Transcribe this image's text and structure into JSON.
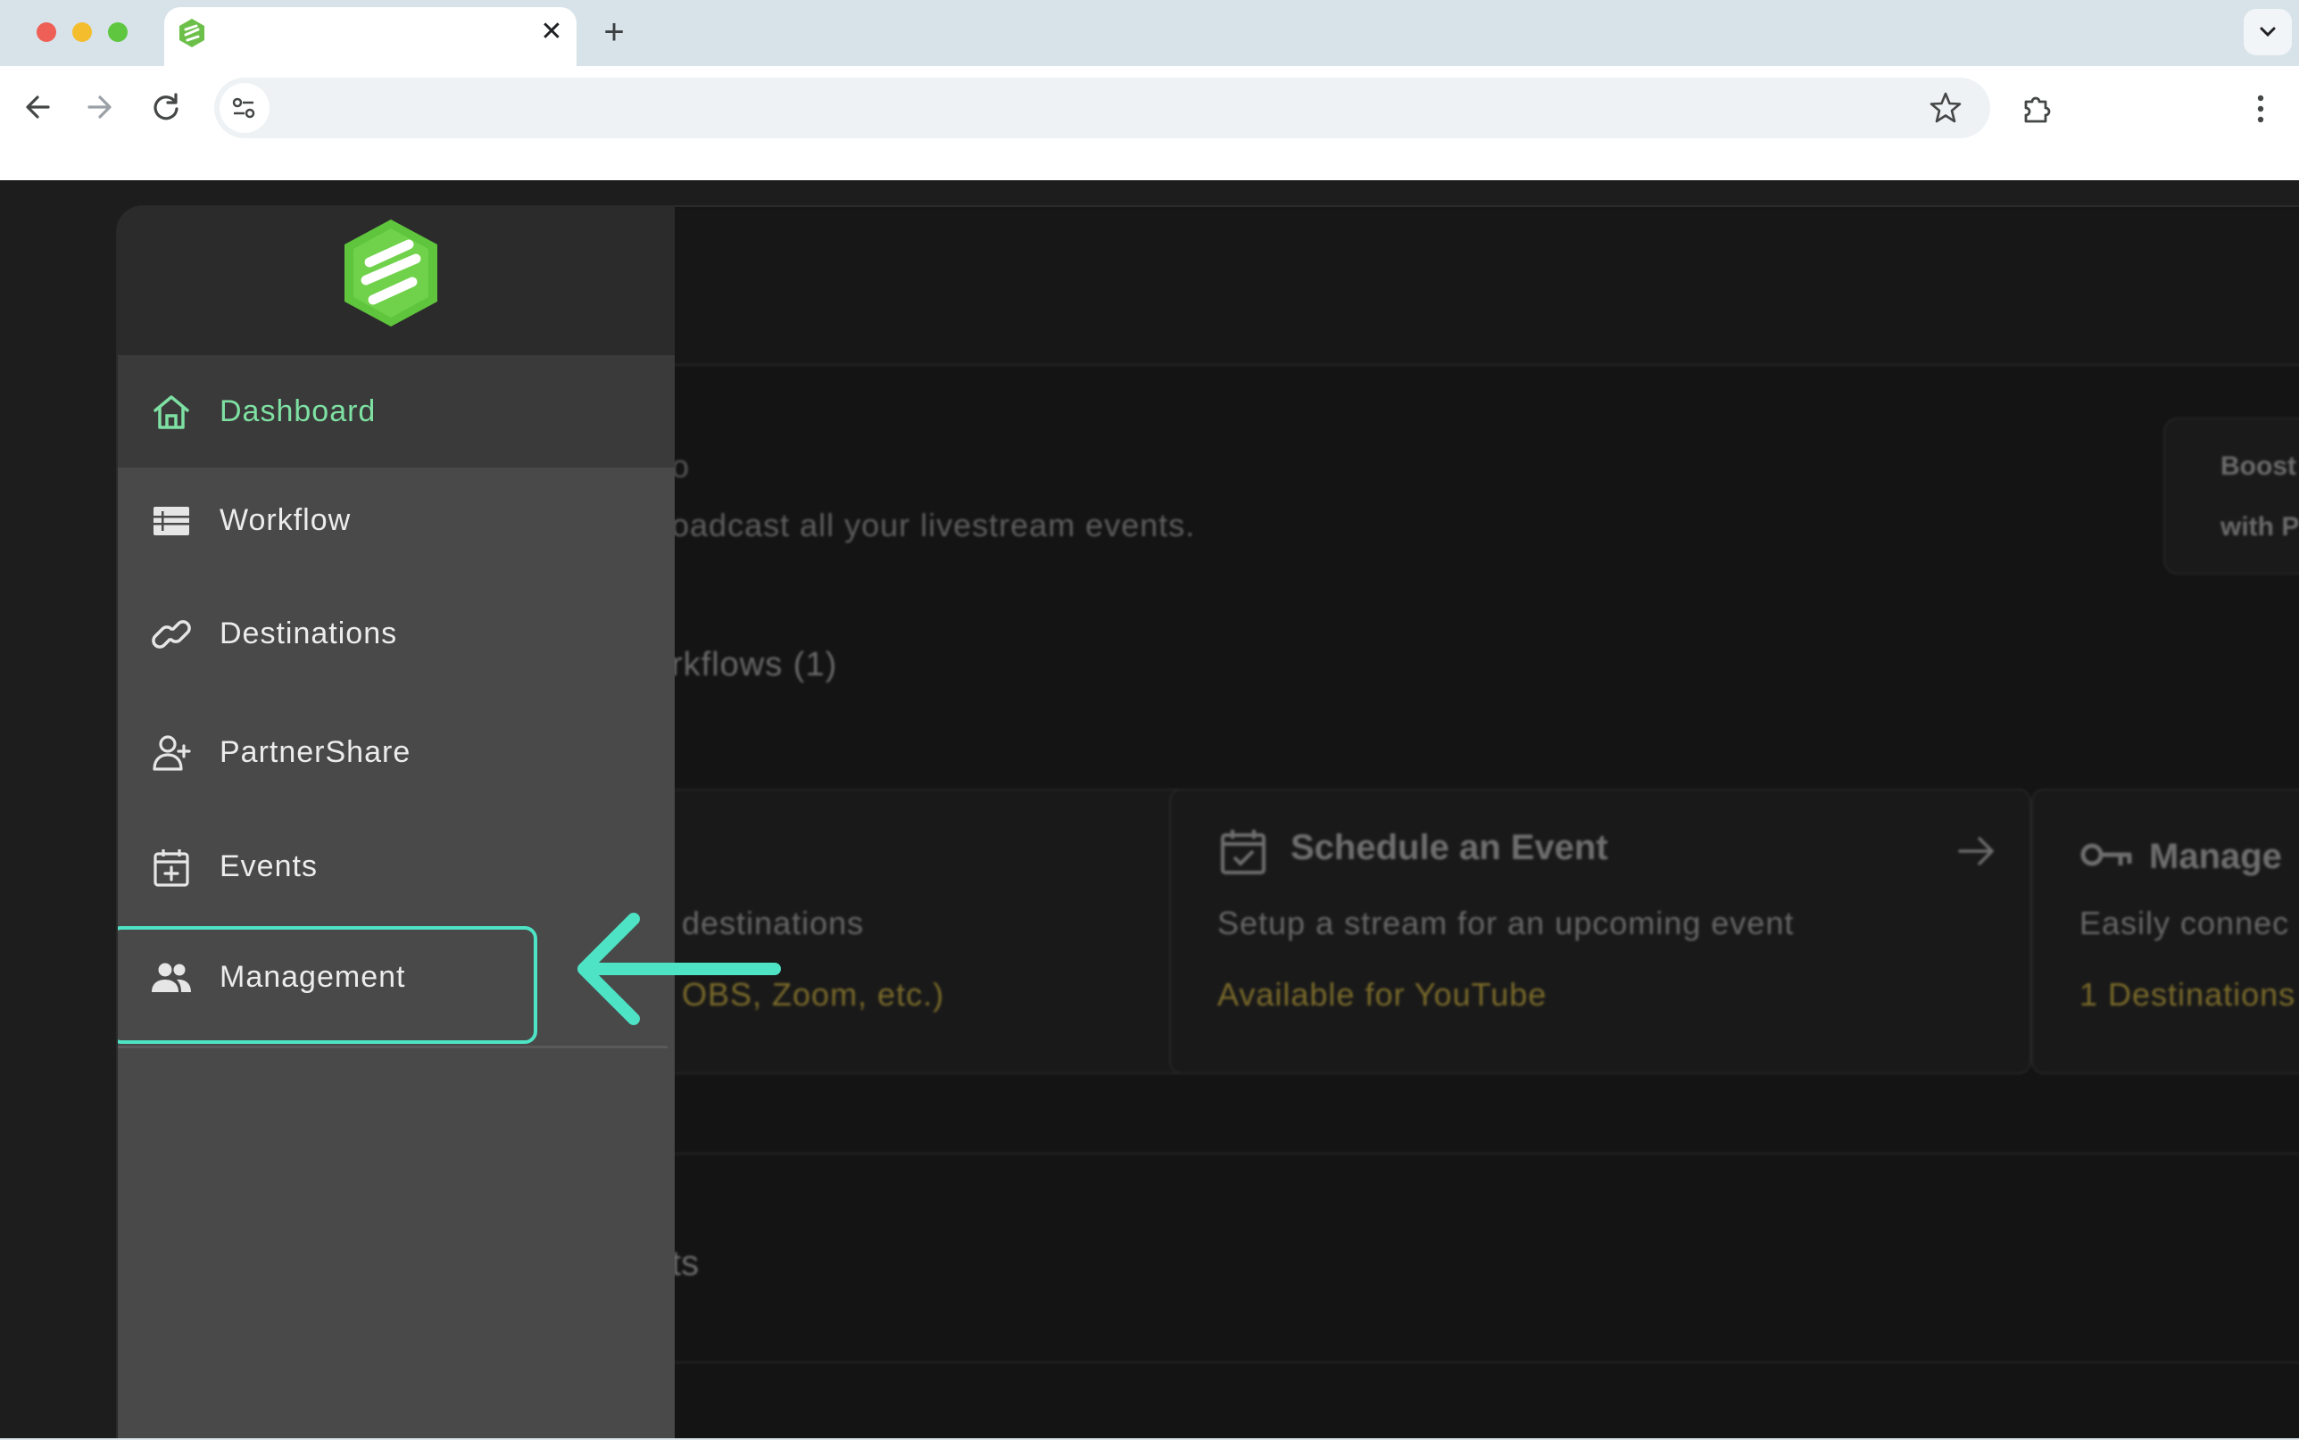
{
  "browser": {
    "tab": {
      "close_glyph": "✕"
    },
    "new_tab_glyph": "+"
  },
  "main": {
    "title_fragment": "o",
    "subtitle": "oadcast all your livestream events.",
    "workflows_heading": "rkflows (1)",
    "promo": {
      "line1": "Boost",
      "line2": "with P"
    },
    "cards": [
      {
        "title": "",
        "description": "destinations",
        "link": "OBS, Zoom, etc.)"
      },
      {
        "title": "Schedule an Event",
        "description": "Setup a stream for an upcoming event",
        "link": "Available for YouTube"
      },
      {
        "title": "Manage",
        "description": "Easily connec",
        "link": "1 Destinations"
      }
    ],
    "events_heading": "ts"
  },
  "sidebar": {
    "items": [
      {
        "label": "Dashboard",
        "icon": "home-icon",
        "active": true
      },
      {
        "label": "Workflow",
        "icon": "list-icon"
      },
      {
        "label": "Destinations",
        "icon": "link-icon"
      },
      {
        "label": "PartnerShare",
        "icon": "person-add-icon"
      },
      {
        "label": "Events",
        "icon": "calendar-add-icon"
      },
      {
        "label": "Management",
        "icon": "people-icon",
        "highlighted": true
      }
    ]
  },
  "colors": {
    "accent_green": "#7ee0a2",
    "highlight_teal": "#4ee3c5",
    "link_gold": "#7a6a2a",
    "sidebar_bg": "#494949"
  }
}
